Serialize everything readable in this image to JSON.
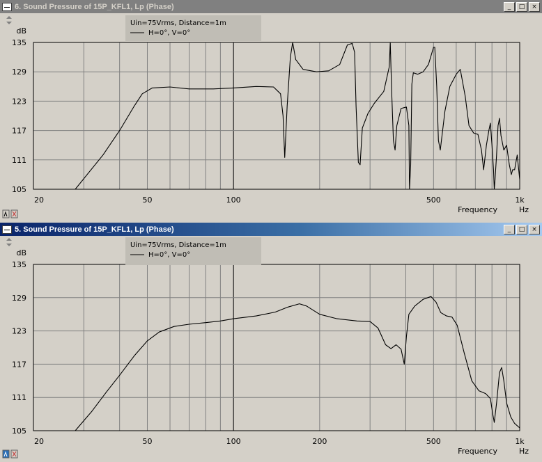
{
  "windows": [
    {
      "title": "6. Sound Pressure of 15P_KFL1, Lp (Phase)",
      "active": false,
      "buttons": {
        "minimize": "_",
        "maximize": "□",
        "close": "×"
      }
    },
    {
      "title": "5. Sound Pressure of 15P_KFL1, Lp (Phase)",
      "active": true,
      "buttons": {
        "minimize": "_",
        "maximize": "□",
        "close": "×"
      }
    }
  ],
  "chart_data": [
    {
      "type": "line",
      "xscale": "log",
      "xlim": [
        20,
        1000
      ],
      "ylim": [
        105,
        135
      ],
      "ylabel": "dB",
      "xlabel": "Frequency",
      "xunit": "Hz",
      "yticks": [
        105,
        111,
        117,
        123,
        129,
        135
      ],
      "yticklabels": [
        "105",
        "111",
        "117",
        "123",
        "129",
        "135"
      ],
      "xticklabels": [
        {
          "value": 20,
          "label": "20"
        },
        {
          "value": 50,
          "label": "50"
        },
        {
          "value": 100,
          "label": "100"
        },
        {
          "value": 500,
          "label": "500"
        },
        {
          "value": 1000,
          "label": "1k"
        }
      ],
      "xgrid": [
        30,
        40,
        50,
        60,
        70,
        80,
        90,
        100,
        200,
        300,
        400,
        500,
        600,
        700,
        800,
        900
      ],
      "grid": true,
      "legend": {
        "placement": "top-left",
        "header": "Uin=75Vrms, Distance=1m",
        "entries": [
          "H=0°, V=0°"
        ]
      },
      "series": [
        {
          "name": "H=0°, V=0°",
          "color": "#000000",
          "points": [
            [
              20,
              105
            ],
            [
              28,
              105
            ],
            [
              35,
              112
            ],
            [
              40,
              117
            ],
            [
              45,
              122
            ],
            [
              48,
              124.5
            ],
            [
              52,
              125.7
            ],
            [
              60,
              125.9
            ],
            [
              70,
              125.5
            ],
            [
              85,
              125.5
            ],
            [
              100,
              125.7
            ],
            [
              120,
              126
            ],
            [
              138,
              125.9
            ],
            [
              146,
              124.5
            ],
            [
              149,
              120
            ],
            [
              151,
              111.5
            ],
            [
              154,
              122
            ],
            [
              158,
              132
            ],
            [
              161,
              135
            ],
            [
              165,
              131.5
            ],
            [
              175,
              129.5
            ],
            [
              195,
              129
            ],
            [
              215,
              129.2
            ],
            [
              235,
              130.5
            ],
            [
              250,
              134.5
            ],
            [
              260,
              134.8
            ],
            [
              265,
              133
            ],
            [
              268,
              122
            ],
            [
              273,
              110.5
            ],
            [
              277,
              110
            ],
            [
              282,
              117.5
            ],
            [
              295,
              120.5
            ],
            [
              310,
              122.5
            ],
            [
              335,
              125
            ],
            [
              350,
              130
            ],
            [
              353,
              135
            ],
            [
              357,
              125
            ],
            [
              362,
              115
            ],
            [
              367,
              113
            ],
            [
              372,
              118
            ],
            [
              385,
              121.5
            ],
            [
              402,
              121.8
            ],
            [
              410,
              118
            ],
            [
              412,
              105
            ],
            [
              416,
              110
            ],
            [
              420,
              126.5
            ],
            [
              425,
              128.8
            ],
            [
              440,
              128.5
            ],
            [
              460,
              129
            ],
            [
              480,
              130.5
            ],
            [
              500,
              134
            ],
            [
              505,
              134
            ],
            [
              513,
              126
            ],
            [
              520,
              115
            ],
            [
              528,
              113
            ],
            [
              548,
              121
            ],
            [
              570,
              126
            ],
            [
              600,
              128.5
            ],
            [
              620,
              129.5
            ],
            [
              645,
              124
            ],
            [
              665,
              118
            ],
            [
              690,
              116.5
            ],
            [
              715,
              116.2
            ],
            [
              735,
              113
            ],
            [
              748,
              109
            ],
            [
              765,
              114
            ],
            [
              780,
              117
            ],
            [
              790,
              118.5
            ],
            [
              800,
              114
            ],
            [
              810,
              109
            ],
            [
              815,
              105
            ],
            [
              820,
              107
            ],
            [
              830,
              112
            ],
            [
              840,
              118
            ],
            [
              850,
              119.5
            ],
            [
              860,
              116
            ],
            [
              880,
              113
            ],
            [
              900,
              114
            ],
            [
              920,
              110
            ],
            [
              935,
              108
            ],
            [
              945,
              109
            ],
            [
              960,
              109
            ],
            [
              980,
              112
            ],
            [
              1000,
              107
            ]
          ]
        }
      ]
    },
    {
      "type": "line",
      "xscale": "log",
      "xlim": [
        20,
        1000
      ],
      "ylim": [
        105,
        135
      ],
      "ylabel": "dB",
      "xlabel": "Frequency",
      "xunit": "Hz",
      "yticks": [
        105,
        111,
        117,
        123,
        129,
        135
      ],
      "yticklabels": [
        "105",
        "111",
        "117",
        "123",
        "129",
        "135"
      ],
      "xticklabels": [
        {
          "value": 20,
          "label": "20"
        },
        {
          "value": 50,
          "label": "50"
        },
        {
          "value": 100,
          "label": "100"
        },
        {
          "value": 200,
          "label": "200"
        },
        {
          "value": 500,
          "label": "500"
        },
        {
          "value": 1000,
          "label": "1k"
        }
      ],
      "xgrid": [
        30,
        40,
        50,
        60,
        70,
        80,
        90,
        100,
        200,
        300,
        400,
        500,
        600,
        700,
        800,
        900
      ],
      "grid": true,
      "legend": {
        "placement": "top-left",
        "header": "Uin=75Vrms, Distance=1m",
        "entries": [
          "H=0°, V=0°"
        ]
      },
      "series": [
        {
          "name": "H=0°, V=0°",
          "color": "#000000",
          "points": [
            [
              20,
              105
            ],
            [
              28,
              105
            ],
            [
              32,
              108.5
            ],
            [
              36,
              112
            ],
            [
              40,
              115
            ],
            [
              45,
              118.5
            ],
            [
              50,
              121.2
            ],
            [
              55,
              122.8
            ],
            [
              62,
              123.8
            ],
            [
              70,
              124.2
            ],
            [
              80,
              124.5
            ],
            [
              90,
              124.8
            ],
            [
              100,
              125.2
            ],
            [
              120,
              125.7
            ],
            [
              140,
              126.4
            ],
            [
              155,
              127.3
            ],
            [
              170,
              127.9
            ],
            [
              180,
              127.5
            ],
            [
              200,
              126
            ],
            [
              230,
              125.2
            ],
            [
              270,
              124.8
            ],
            [
              300,
              124.7
            ],
            [
              320,
              123.5
            ],
            [
              340,
              120.5
            ],
            [
              355,
              119.8
            ],
            [
              370,
              120.5
            ],
            [
              385,
              119.7
            ],
            [
              395,
              117
            ],
            [
              402,
              122
            ],
            [
              410,
              126
            ],
            [
              430,
              127.5
            ],
            [
              460,
              128.7
            ],
            [
              490,
              129.2
            ],
            [
              510,
              128.2
            ],
            [
              530,
              126.3
            ],
            [
              555,
              125.7
            ],
            [
              580,
              125.5
            ],
            [
              605,
              124
            ],
            [
              640,
              119
            ],
            [
              680,
              114
            ],
            [
              720,
              112.2
            ],
            [
              760,
              111.7
            ],
            [
              790,
              110.8
            ],
            [
              805,
              108
            ],
            [
              815,
              106.5
            ],
            [
              830,
              110
            ],
            [
              850,
              115.5
            ],
            [
              865,
              116.4
            ],
            [
              880,
              114
            ],
            [
              900,
              110
            ],
            [
              930,
              107.5
            ],
            [
              960,
              106.3
            ],
            [
              1000,
              105.5
            ]
          ]
        }
      ]
    }
  ]
}
